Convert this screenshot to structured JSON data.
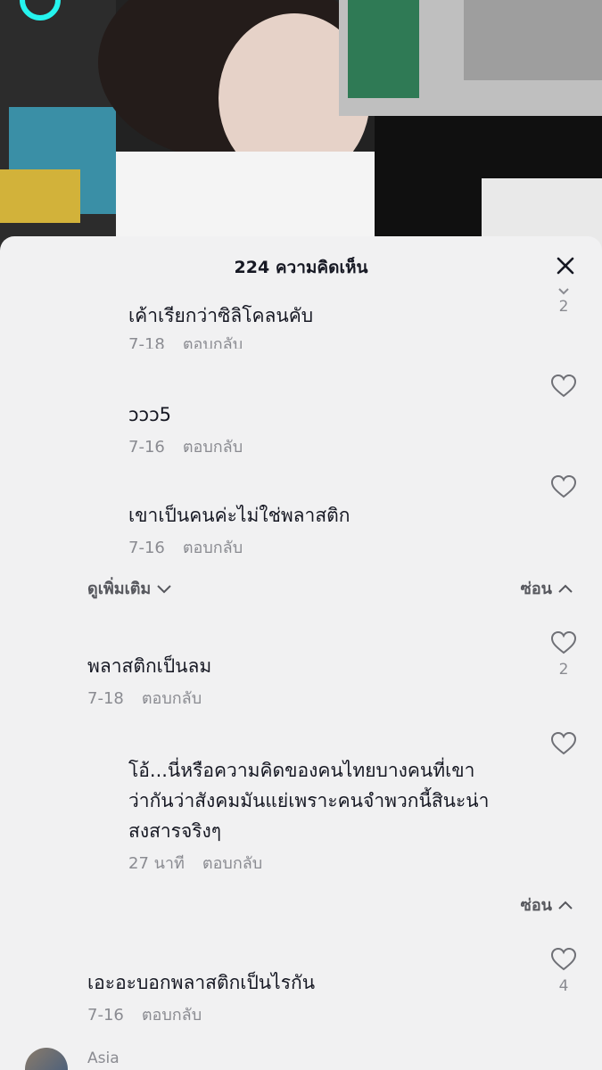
{
  "header": {
    "title": "224 ความคิดเห็น"
  },
  "labels": {
    "reply": "ตอบกลับ"
  },
  "colors": {
    "sheet_bg": "#f1f1f2",
    "text": "#161823",
    "meta": "#8a8b91"
  },
  "icons": {
    "close": "close-icon",
    "like": "heart-outline-icon",
    "chevron_down": "chevron-down-icon",
    "chevron_up": "chevron-up-icon"
  },
  "comments": [
    {
      "text": "เค้าเรียกว่าซิลิโคลนคับ",
      "date": "7-18",
      "reply": "ตอบกลับ",
      "likes": "2"
    },
    {
      "text": "ɔɔɔ5",
      "date": "7-16",
      "reply": "ตอบกลับ",
      "likes": ""
    },
    {
      "text": "เขาเป็นคนค่ะไม่ใช่พลาสติก",
      "date": "7-16",
      "reply": "ตอบกลับ",
      "likes": ""
    },
    {
      "text": "พลาสติกเป็นลม",
      "date": "7-18",
      "reply": "ตอบกลับ",
      "likes": "2"
    },
    {
      "text": "โอ้...นี่หรือความคิดของคนไทยบางคนที่เขา\nว่ากันว่าสังคมมันแย่เพราะคนจำพวกนี้สินะน่า\nสงสารจริงๆ",
      "date": "27 นาที",
      "reply": "ตอบกลับ",
      "likes": ""
    },
    {
      "text": "เอะอะบอกพลาสติกเป็นไรกัน",
      "date": "7-16",
      "reply": "ตอบกลับ",
      "likes": "4"
    }
  ],
  "toggles": {
    "view_more": "ดูเพิ่มเติม",
    "hide": "ซ่อน"
  },
  "next_user": {
    "name": "Asia"
  }
}
